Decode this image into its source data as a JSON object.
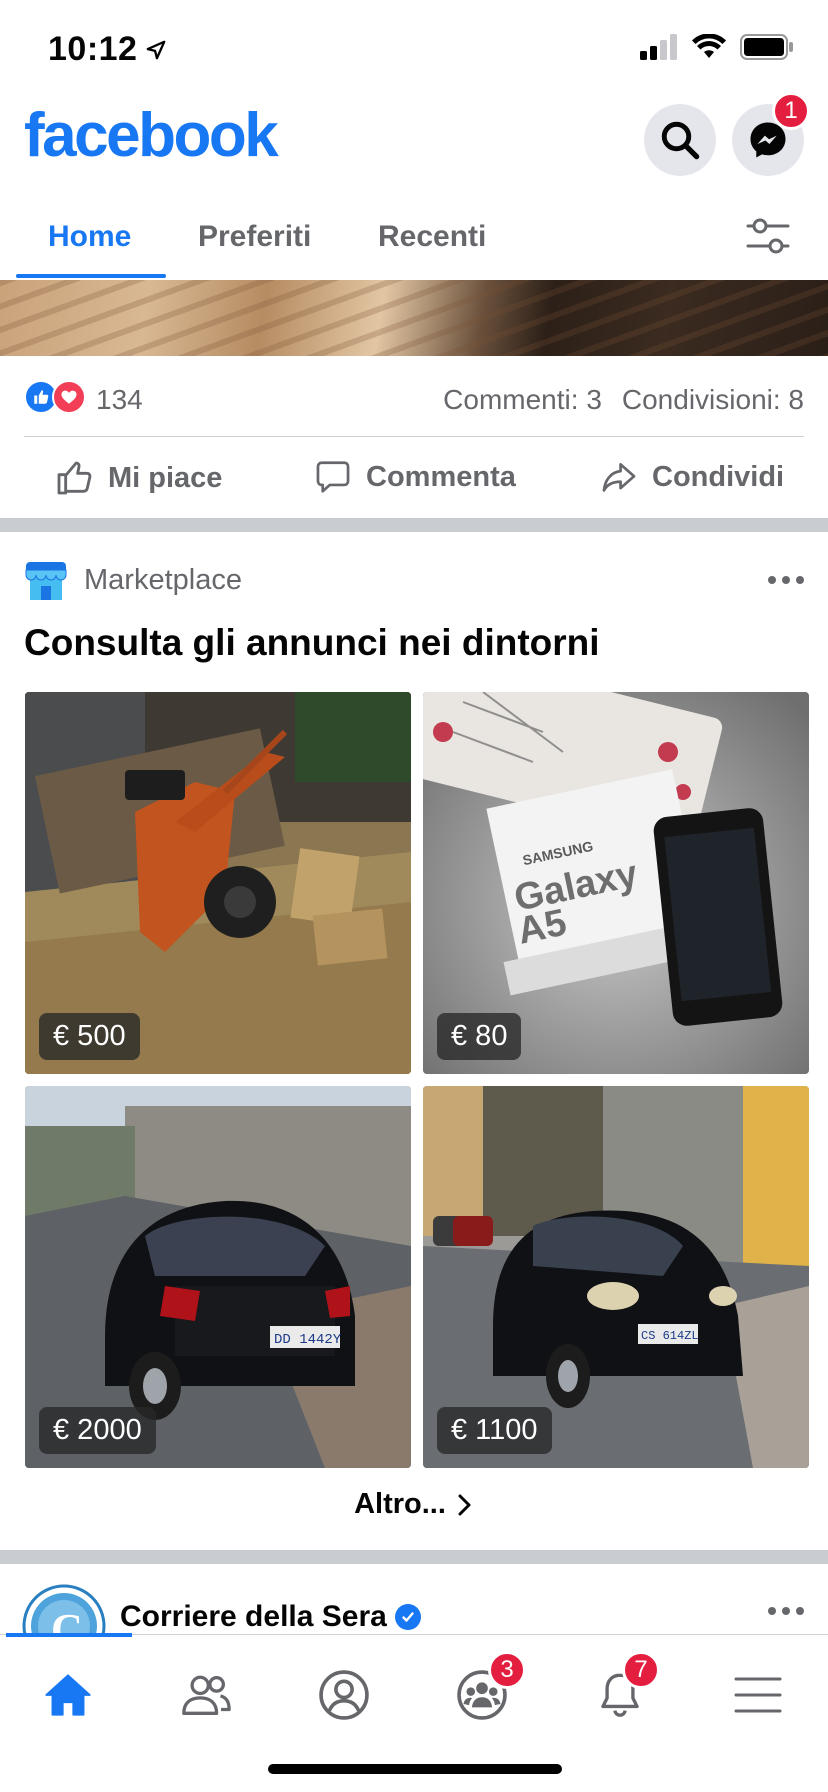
{
  "status_bar": {
    "time": "10:12"
  },
  "header": {
    "logo": "facebook",
    "messenger_badge": "1"
  },
  "tabs": [
    {
      "label": "Home",
      "active": true
    },
    {
      "label": "Preferiti",
      "active": false
    },
    {
      "label": "Recenti",
      "active": false
    }
  ],
  "post": {
    "reaction_count": "134",
    "comments": "Commenti: 3",
    "shares": "Condivisioni: 8",
    "actions": {
      "like": "Mi piace",
      "comment": "Commenta",
      "share": "Condividi"
    }
  },
  "marketplace": {
    "label": "Marketplace",
    "title": "Consulta gli annunci nei dintorni",
    "items": [
      {
        "price": "€ 500",
        "icon": "tiller-photo"
      },
      {
        "price": "€ 80",
        "icon": "phone-photo",
        "box_brand": "SAMSUNG",
        "box_model_1": "Galaxy",
        "box_model_2": "A5"
      },
      {
        "price": "€ 2000",
        "icon": "car-photo",
        "plate": "DD 1442Y"
      },
      {
        "price": "€ 1100",
        "icon": "car-photo",
        "plate": "CS 614ZL"
      }
    ],
    "more": "Altro..."
  },
  "next_post": {
    "page_name": "Corriere della Sera",
    "verified": true
  },
  "bottom_nav": {
    "groups_badge": "3",
    "notifications_badge": "7"
  },
  "colors": {
    "brand": "#1877f2",
    "badge": "#e41e3f",
    "secondary_text": "#65676b"
  }
}
